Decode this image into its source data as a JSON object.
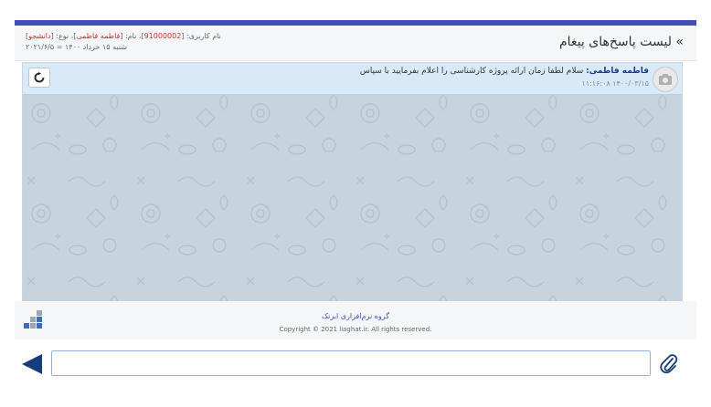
{
  "header": {
    "title": "» لیست پاسخ‌های پیغام",
    "user_line_prefix": "نام کاربری: [",
    "username": "91000002",
    "name_prefix": "]، نام: [",
    "name": "فاطمه فاطمی",
    "type_prefix": "]، نوع: [",
    "user_type": "دانشجو",
    "type_suffix": "]",
    "date_line": "شنبه ۱۵ خرداد ۱۴۰۰ = ۲۰۲۱/۶/۵"
  },
  "message": {
    "sender": "فاطمه فاطمی:",
    "text": " سلام لطفا زمان ارائه پروژه کارشناسی را اعلام بفرمایید با سپاس",
    "timestamp": "۱۴۰۰/۰۳/۱۵ ۱۱:۱۶:۰۸"
  },
  "footer": {
    "company": "گروه نرم‌افزاری ابرتک",
    "copyright": "Copyright © 2021 liaghat.ir. All rights reserved."
  },
  "composer": {
    "input_value": "",
    "input_placeholder": ""
  },
  "colors": {
    "accent": "#3f51b5",
    "send_button": "#163d7a",
    "chat_background": "#c7d4de",
    "message_bar": "#d8eaf7"
  },
  "icons": {
    "refresh": "refresh-icon",
    "avatar": "camera-avatar-icon",
    "send": "send-arrow-icon",
    "attach": "paperclip-icon",
    "logo": "blocks-logo-icon"
  }
}
